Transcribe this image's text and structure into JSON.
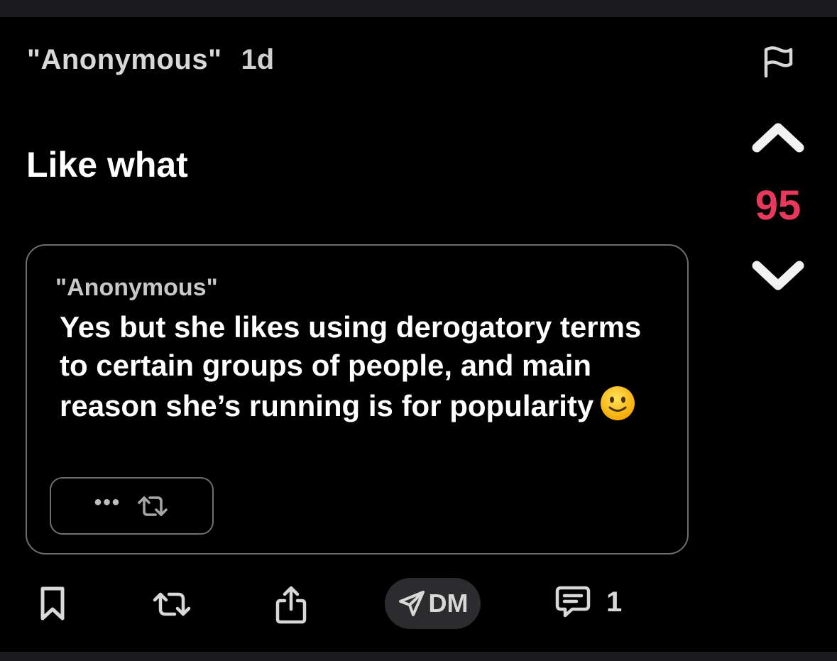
{
  "post": {
    "author": "\"Anonymous\"",
    "timestamp": "1d",
    "body": "Like what",
    "votes": "95"
  },
  "quote": {
    "author": "\"Anonymous\"",
    "text": "Yes but she likes using derogatory terms to certain groups of people, and main reason she’s running is for popularity",
    "emoji": "slightly-smiling-face-icon",
    "more_label": "•••"
  },
  "actions": {
    "dm_label": "DM",
    "comment_count": "1"
  },
  "colors": {
    "background": "#000000",
    "vote_count": "#e8395d",
    "dm_pill": "#2c2c2e",
    "border": "#6e6e6e"
  }
}
